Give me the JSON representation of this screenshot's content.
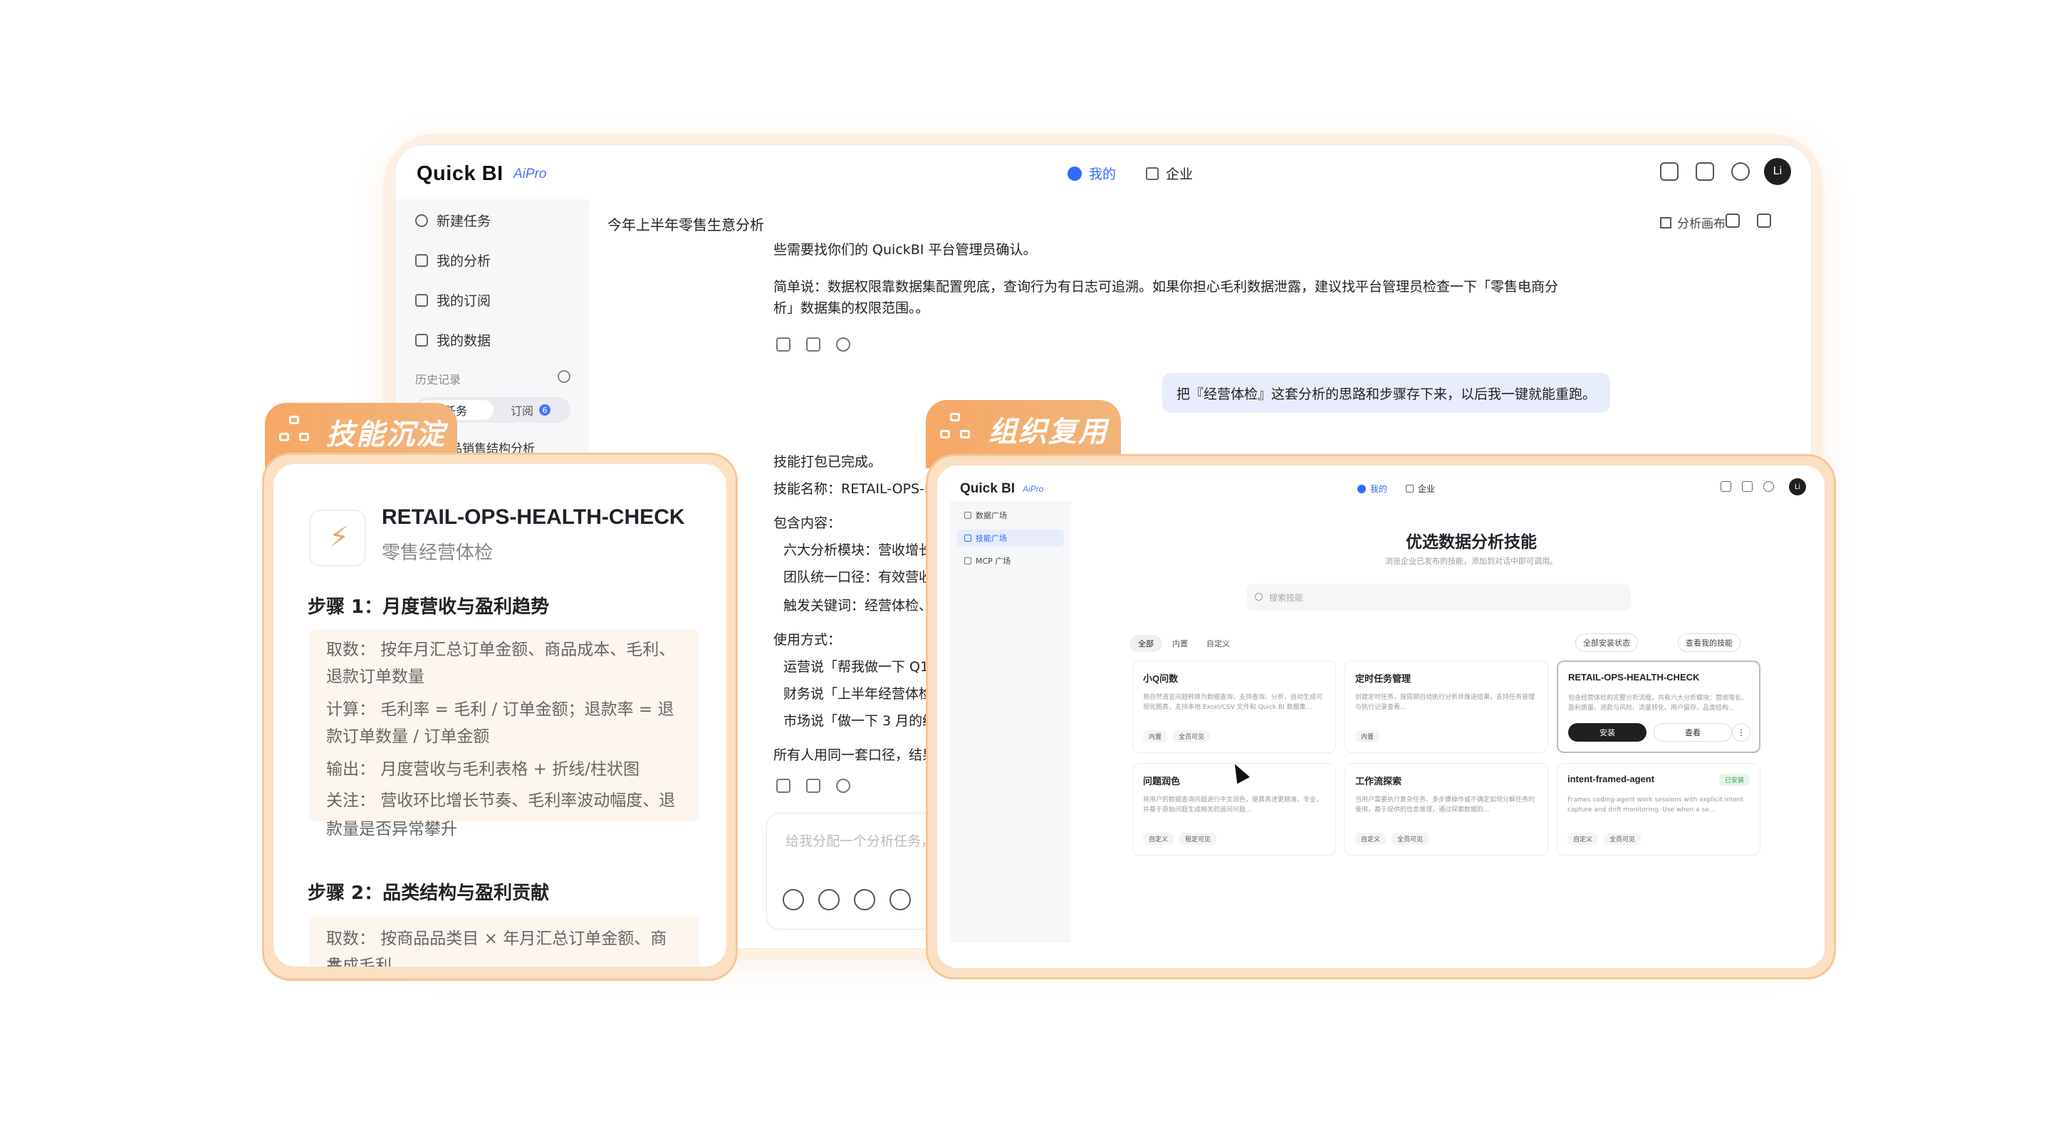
{
  "main_window": {
    "logo": "Quick BI",
    "logo_pro": "AiPro",
    "tabs": [
      {
        "label": "我的"
      },
      {
        "label": "企业"
      }
    ],
    "avatar": "Li",
    "sidebar": {
      "items": [
        {
          "label": "新建任务"
        },
        {
          "label": "我的分析"
        },
        {
          "label": "我的订阅"
        },
        {
          "label": "我的数据"
        }
      ],
      "history_title": "历史记录",
      "segment": {
        "tasks": "任务",
        "subscriptions": "订阅",
        "sub_count": "6"
      },
      "history_items": [
        "商品销售结构分析"
      ]
    },
    "chat_title": "今年上半年零售生意分析",
    "canvas_button": "分析画布",
    "messages": {
      "m1": "些需要找你们的 QuickBI 平台管理员确认。",
      "m2a": "简单说：数据权限靠数据集配置兜底，查询行为有日志可追溯。如果你担心毛利数据泄露，建议找平台管理员检查一下「零售电商分",
      "m2b": "析」数据集的权限范围。。",
      "user": "把『经营体检』这套分析的思路和步骤存下来，以后我一键就能重跑。",
      "done": "技能打包已完成。",
      "skill_name": "技能名称：RETAIL-OPS-HEALTH-CHECK",
      "contains": "包含内容：",
      "c1": "六大分析模块：营收增长、",
      "c2": "团队统一口径：有效营收",
      "c3": "触发关键词：经营体检、",
      "usage": "使用方式：",
      "u1": "运营说「帮我做一下 Q1",
      "u2": "财务说「上半年经营体检",
      "u3": "市场说「做一下 3 月的经",
      "last": "所有人用同一套口径，结果"
    },
    "input_placeholder": "给我分配一个分析任务，"
  },
  "skill_card": {
    "tab_label": "技能沉淀",
    "name": "RETAIL-OPS-HEALTH-CHECK",
    "subtitle": "零售经营体检",
    "step1": {
      "title": "步骤 1：月度营收与盈利趋势",
      "lines": [
        "取数：  按年月汇总订单金额、商品成本、毛利、",
        "退款订单数量",
        "计算：  毛利率 = 毛利 / 订单金额；退款率 = 退",
        "款订单数量 / 订单金额",
        "输出：  月度营收与毛利表格 + 折线/柱状图",
        "关注：  营收环比增长节奏、毛利率波动幅度、退",
        "款量是否异常攀升"
      ]
    },
    "step2": {
      "title": "步骤 2：品类结构与盈利贡献",
      "lines": [
        "取数：  按商品品类目 × 年月汇总订单金额、商品成",
        "本、毛利"
      ]
    }
  },
  "org_card": {
    "tab_label": "组织复用",
    "window": {
      "logo": "Quick BI",
      "logo_pro": "AiPro",
      "tabs": [
        {
          "label": "我的"
        },
        {
          "label": "企业"
        }
      ],
      "avatar": "Li",
      "sidebar": [
        {
          "label": "数据广场"
        },
        {
          "label": "技能广场"
        },
        {
          "label": "MCP 广场"
        }
      ],
      "heading": "优选数据分析技能",
      "subheading": "浏览企业已发布的技能，添加到对话中即可调用。",
      "search_placeholder": "搜索技能",
      "filters": [
        "全部",
        "内置",
        "自定义"
      ],
      "right_buttons": [
        "全部安装状态",
        "查看我的技能"
      ],
      "cards": [
        {
          "title": "小Q问数",
          "desc": "将自然语言问题转换为数据查询，支持查询、分析，自动生成可视化图表，支持本地 Excel/CSV 文件和 Quick BI 数据集...",
          "tags": [
            "内置",
            "全员可见"
          ]
        },
        {
          "title": "定时任务管理",
          "desc": "创建定时任务，按周期自动执行分析并推送结果，支持任务管理与执行记录查看...",
          "tags": [
            "内置"
          ]
        },
        {
          "title": "RETAIL-OPS-HEALTH-CHECK",
          "desc": "包含经营体检的完整分析流程，共有六大分析模块：营收增长、盈利质量、退款与风险、流量转化、用户留存、品类结构...",
          "buttons": {
            "install": "安装",
            "view": "查看",
            "more": "⋮"
          }
        },
        {
          "title": "问题润色",
          "desc": "将用户的数据查询问题进行中文润色，使其表述更精准、专业，并基于原始问题生成相关的追问问题...",
          "tags": [
            "自定义",
            "租定可见"
          ]
        },
        {
          "title": "工作流探索",
          "desc": "当用户需要执行复杂任务、多步骤操作或不确定如何分解任务时使用，基于提供的信息推理，通过探索数据的...",
          "tags": [
            "自定义",
            "全员可见"
          ]
        },
        {
          "title": "intent-framed-agent",
          "desc": "Frames coding-agent work sessions with explicit intent capture and drift monitoring. Use when a se...",
          "tags": [
            "自定义",
            "全员可见"
          ],
          "status": "已安装"
        }
      ]
    }
  },
  "colors": {
    "accent": "#2f6bff",
    "orange": "#f6a866",
    "frame": "#fbe0c4"
  }
}
